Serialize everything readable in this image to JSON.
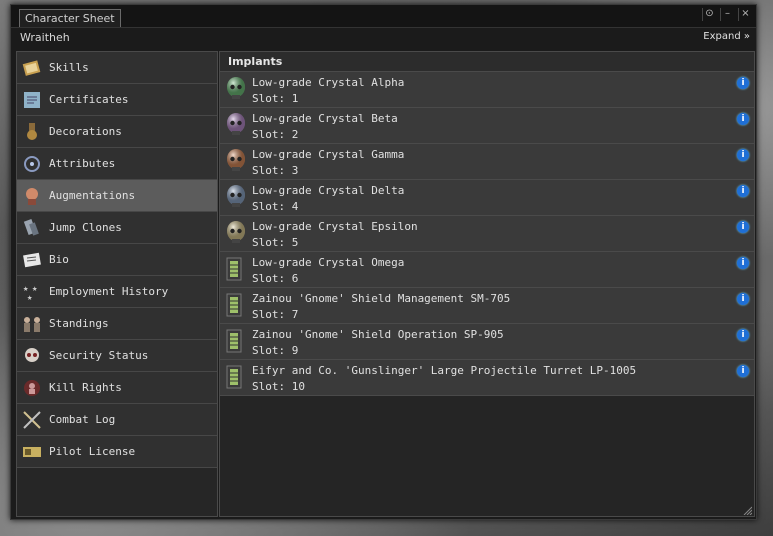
{
  "window": {
    "title": "Character Sheet",
    "character_name": "Wraitheh",
    "expand_label": "Expand"
  },
  "sidebar": {
    "selected": "Augmentations",
    "items": [
      {
        "label": "Skills",
        "icon": "book-icon"
      },
      {
        "label": "Certificates",
        "icon": "certificate-icon"
      },
      {
        "label": "Decorations",
        "icon": "medal-icon"
      },
      {
        "label": "Attributes",
        "icon": "attributes-icon"
      },
      {
        "label": "Augmentations",
        "icon": "head-icon"
      },
      {
        "label": "Jump Clones",
        "icon": "clone-icon"
      },
      {
        "label": "Bio",
        "icon": "bio-icon"
      },
      {
        "label": "Employment History",
        "icon": "stars-icon"
      },
      {
        "label": "Standings",
        "icon": "standings-icon"
      },
      {
        "label": "Security Status",
        "icon": "skull-icon"
      },
      {
        "label": "Kill Rights",
        "icon": "target-icon"
      },
      {
        "label": "Combat Log",
        "icon": "swords-icon"
      },
      {
        "label": "Pilot License",
        "icon": "license-icon"
      }
    ]
  },
  "implants": {
    "header": "Implants",
    "items": [
      {
        "name": "Low-grade Crystal Alpha",
        "slot": "Slot: 1",
        "icon": "skull-implant-icon",
        "color": "#6fbf7a"
      },
      {
        "name": "Low-grade Crystal Beta",
        "slot": "Slot: 2",
        "icon": "skull-implant-icon",
        "color": "#b58ac9"
      },
      {
        "name": "Low-grade Crystal Gamma",
        "slot": "Slot: 3",
        "icon": "skull-implant-icon",
        "color": "#d98a5a"
      },
      {
        "name": "Low-grade Crystal Delta",
        "slot": "Slot: 4",
        "icon": "skull-implant-icon",
        "color": "#8ea6c8"
      },
      {
        "name": "Low-grade Crystal Epsilon",
        "slot": "Slot: 5",
        "icon": "skull-implant-icon",
        "color": "#d8c890"
      },
      {
        "name": "Low-grade Crystal Omega",
        "slot": "Slot: 6",
        "icon": "hardwiring-icon",
        "color": "#9ec06a"
      },
      {
        "name": "Zainou 'Gnome' Shield Management SM-705",
        "slot": "Slot: 7",
        "icon": "hardwiring-icon",
        "color": "#9ec06a"
      },
      {
        "name": "Zainou 'Gnome' Shield Operation SP-905",
        "slot": "Slot: 9",
        "icon": "hardwiring-icon",
        "color": "#9ec06a"
      },
      {
        "name": "Eifyr and Co. 'Gunslinger' Large Projectile Turret LP-1005",
        "slot": "Slot: 10",
        "icon": "hardwiring-icon",
        "color": "#9ec06a"
      }
    ]
  }
}
